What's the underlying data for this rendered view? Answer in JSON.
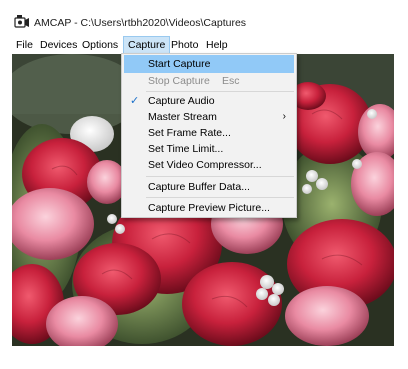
{
  "window": {
    "title": "AMCAP - C:\\Users\\rtbh2020\\Videos\\Captures",
    "icon": "camera-app-icon"
  },
  "menubar": {
    "items": [
      "File",
      "Devices",
      "Options",
      "Capture",
      "Photo",
      "Help"
    ],
    "active": "Capture"
  },
  "capture_menu": {
    "start_capture": "Start Capture",
    "stop_capture": "Stop Capture",
    "stop_shortcut": "Esc",
    "capture_audio": "Capture Audio",
    "capture_audio_checked": true,
    "master_stream": "Master Stream",
    "submenu_arrow": "›",
    "set_frame_rate": "Set Frame Rate...",
    "set_time_limit": "Set Time Limit...",
    "set_video_compressor": "Set Video Compressor...",
    "capture_buffer_data": "Capture Buffer Data...",
    "capture_preview_picture": "Capture Preview Picture...",
    "check_glyph": "✓"
  },
  "preview": {
    "content": "carnation-flowers-video-feed"
  },
  "colors": {
    "menu_highlight": "#91c9f7",
    "active_menu": "#cce4f7",
    "checkmark": "#1a6fc9"
  }
}
